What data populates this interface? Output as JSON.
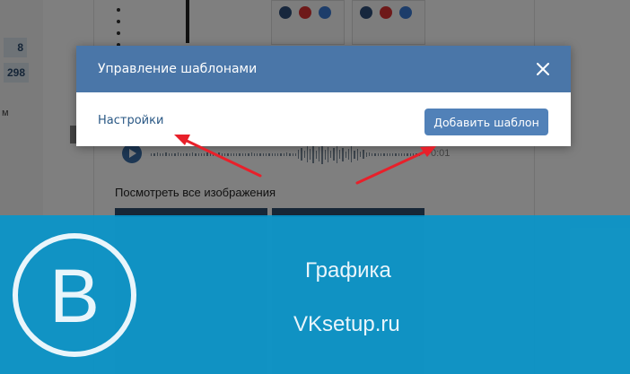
{
  "background": {
    "counts": [
      "8",
      "298"
    ],
    "left_letter": "м",
    "audio_time": "0:01",
    "view_all": "Посмотреть все изображения"
  },
  "modal": {
    "title": "Управление шаблонами",
    "settings_link": "Настройки",
    "add_button": "Добавить шаблон",
    "close_icon": "close-icon"
  },
  "banner": {
    "logo_letter": "B",
    "line1": "Графика",
    "line2": "VKsetup.ru"
  },
  "colors": {
    "header": "#4a76a8",
    "button": "#5181b8",
    "link": "#2a5885",
    "banner": "#0696cc",
    "arrow": "#e8202a"
  }
}
